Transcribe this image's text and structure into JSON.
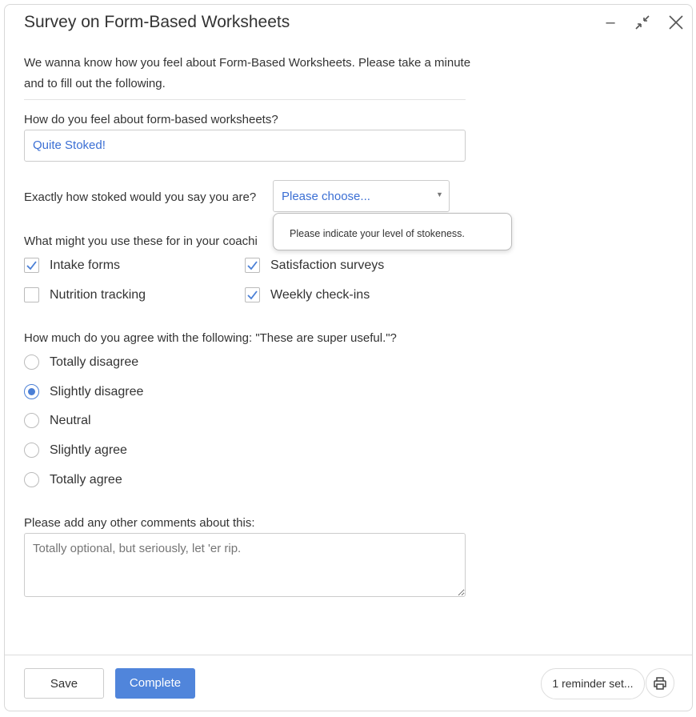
{
  "window": {
    "title": "Survey on Form-Based Worksheets",
    "controls": [
      "minimize-icon",
      "collapse-icon",
      "close-icon"
    ]
  },
  "intro": "We wanna know how you feel about Form-Based Worksheets. Please take a minute and to fill out the following.",
  "q1": {
    "label": "How do you feel about form-based worksheets?",
    "value": "Quite Stoked!"
  },
  "q2": {
    "label": "Exactly how stoked would you say you are?",
    "selected": "Please choose...",
    "tooltip": "Please indicate your level of stokeness."
  },
  "q3": {
    "label": "What might you use these for in your coachi",
    "options": [
      {
        "label": "Intake forms",
        "checked": true
      },
      {
        "label": "Satisfaction surveys",
        "checked": true
      },
      {
        "label": "Nutrition tracking",
        "checked": false
      },
      {
        "label": "Weekly check-ins",
        "checked": true
      }
    ]
  },
  "q4": {
    "label": "How much do you agree with the following: \"These are super useful.\"?",
    "options": [
      "Totally disagree",
      "Slightly disagree",
      "Neutral",
      "Slightly agree",
      "Totally agree"
    ],
    "selected": "Slightly disagree"
  },
  "q5": {
    "label": "Please add any other comments about this:",
    "placeholder": "Totally optional, but seriously, let 'er rip.",
    "value": ""
  },
  "footer": {
    "save": "Save",
    "complete": "Complete",
    "reminder": "1 reminder set...",
    "print_icon": "printer-icon"
  },
  "colors": {
    "accent": "#5085db",
    "link": "#3b6fd4"
  }
}
